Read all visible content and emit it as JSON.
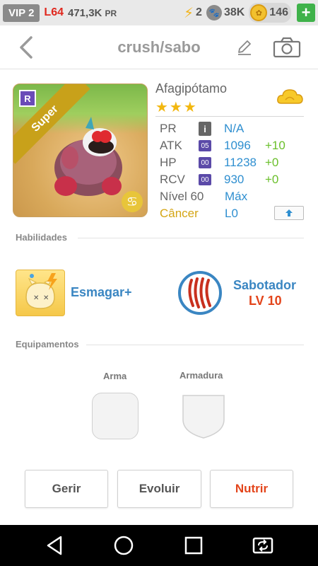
{
  "topbar": {
    "vip": "VIP 2",
    "level": "L64",
    "pr_value": "471,3K",
    "pr_unit": "PR",
    "energy": "2",
    "paw_count": "38K",
    "coins": "146",
    "plus": "+"
  },
  "header": {
    "title": "crush/sabo"
  },
  "monster": {
    "name": "Afagipótamo",
    "stars": "★★★",
    "rarity_ribbon": "Super",
    "rarity_badge": "R",
    "zodiac_glyph": "♋",
    "stats": {
      "pr": {
        "label": "PR",
        "badge": "i",
        "value": "N/A"
      },
      "atk": {
        "label": "ATK",
        "badge": "05",
        "value": "1096",
        "bonus": "+10"
      },
      "hp": {
        "label": "HP",
        "badge": "00",
        "value": "11238",
        "bonus": "+0"
      },
      "rcv": {
        "label": "RCV",
        "badge": "00",
        "value": "930",
        "bonus": "+0"
      },
      "level": {
        "label": "Nível 60",
        "value": "Máx"
      },
      "sign": {
        "label": "Câncer",
        "value": "L0"
      }
    },
    "upgrade_glyph": "🡅"
  },
  "abilities": {
    "section_title": "Habilidades",
    "skill1": {
      "name": "Esmagar+"
    },
    "skill2": {
      "name": "Sabotador",
      "level": "LV 10"
    }
  },
  "equipment": {
    "section_title": "Equipamentos",
    "weapon_label": "Arma",
    "armor_label": "Armadura"
  },
  "actions": {
    "manage": "Gerir",
    "evolve": "Evoluir",
    "feed": "Nutrir"
  },
  "colors": {
    "accent_blue": "#3a86c2",
    "accent_orange": "#e3451b",
    "star_gold": "#f2b70f",
    "bonus_green": "#6abf2a",
    "plus_green": "#3fb24a"
  }
}
